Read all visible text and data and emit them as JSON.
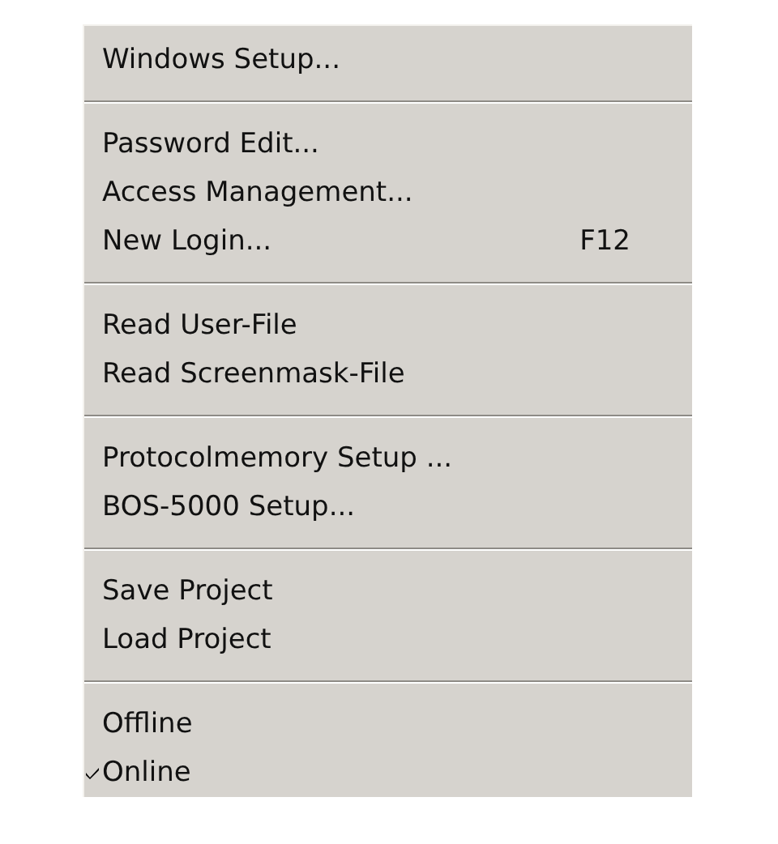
{
  "menu": {
    "groups": [
      {
        "items": [
          {
            "label": "Windows Setup...",
            "checked": false
          }
        ]
      },
      {
        "items": [
          {
            "label": "Password Edit...",
            "checked": false
          },
          {
            "label": "Access Management...",
            "checked": false
          },
          {
            "label": "New Login...",
            "shortcut": "F12",
            "checked": false
          }
        ]
      },
      {
        "items": [
          {
            "label": "Read User-File",
            "checked": false
          },
          {
            "label": "Read Screenmask-File",
            "checked": false
          }
        ]
      },
      {
        "items": [
          {
            "label": "Protocolmemory Setup ...",
            "checked": false
          },
          {
            "label": "BOS-5000 Setup...",
            "checked": false
          }
        ]
      },
      {
        "items": [
          {
            "label": "Save Project",
            "checked": false
          },
          {
            "label": "Load Project",
            "checked": false
          }
        ]
      },
      {
        "items": [
          {
            "label": "Offline",
            "checked": false
          },
          {
            "label": "Online",
            "checked": true
          }
        ]
      }
    ]
  }
}
